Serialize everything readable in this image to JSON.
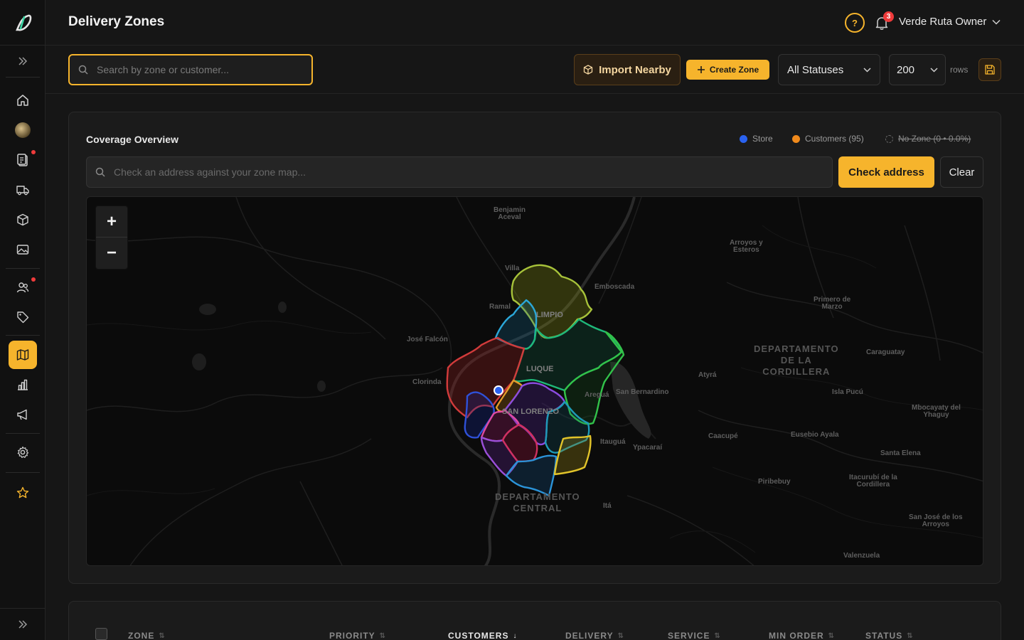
{
  "header": {
    "title": "Delivery Zones",
    "notifications_count": "3",
    "user_name": "Verde Ruta Owner"
  },
  "toolbar": {
    "search_placeholder": "Search by zone or customer...",
    "import_label": "Import Nearby",
    "create_label": "Create Zone",
    "status_value": "All Statuses",
    "rows_value": "200",
    "rows_label": "rows"
  },
  "coverage": {
    "title": "Coverage Overview",
    "legend": {
      "store": "Store",
      "customers": "Customers (95)",
      "no_zone": "No Zone (0 • 0.0%)"
    },
    "address_placeholder": "Check an address against your zone map...",
    "check_label": "Check address",
    "clear_label": "Clear",
    "zoom_in": "+",
    "zoom_out": "−"
  },
  "map": {
    "places": {
      "benjamin": "Benjamin\nAceval",
      "arroyos": "Arroyos y\nEsteros",
      "villa": "Villa",
      "emboscada": "Emboscada",
      "primero": "Primero de\nMarzo",
      "ramal": "Ramal",
      "jose": "José Falcón",
      "clorinda": "Clorinda",
      "caraguatay": "Caraguatay",
      "atyra": "Atyrá",
      "islapucu": "Isla Pucú",
      "sanbernardino": "San Bernardino",
      "aregua": "Areguá",
      "mbocayaty": "Mbocayaty del\nYhaguy",
      "eusebio": "Eusebio Ayala",
      "caacupe": "Caacupé",
      "itaugua": "Itauguá",
      "ypacarai": "Ypacaraí",
      "santaelena": "Santa Elena",
      "piribebuy": "Piribebuy",
      "itacurubi": "Itacurubí de la\nCordillera",
      "ita": "Itá",
      "sanjose": "San José de los\nArroyos",
      "valenzuela": "Valenzuela"
    },
    "regions": {
      "cordillera": "DEPARTAMENTO\nDE LA\nCORDILLERA",
      "central": "DEPARTAMENTO\nCENTRAL"
    },
    "zones": {
      "limpio": "LIMPIO",
      "luque": "LUQUE",
      "sanlorenzo": "SAN LORENZO"
    }
  },
  "table": {
    "columns": [
      "ZONE",
      "PRIORITY",
      "CUSTOMERS",
      "DELIVERY",
      "SERVICE",
      "MIN ORDER",
      "STATUS"
    ],
    "sorted_column": "CUSTOMERS"
  },
  "colors": {
    "accent": "#f6b42c",
    "store": "#2a62f0",
    "customers": "#f08a1c",
    "alert": "#ef3b3b"
  }
}
